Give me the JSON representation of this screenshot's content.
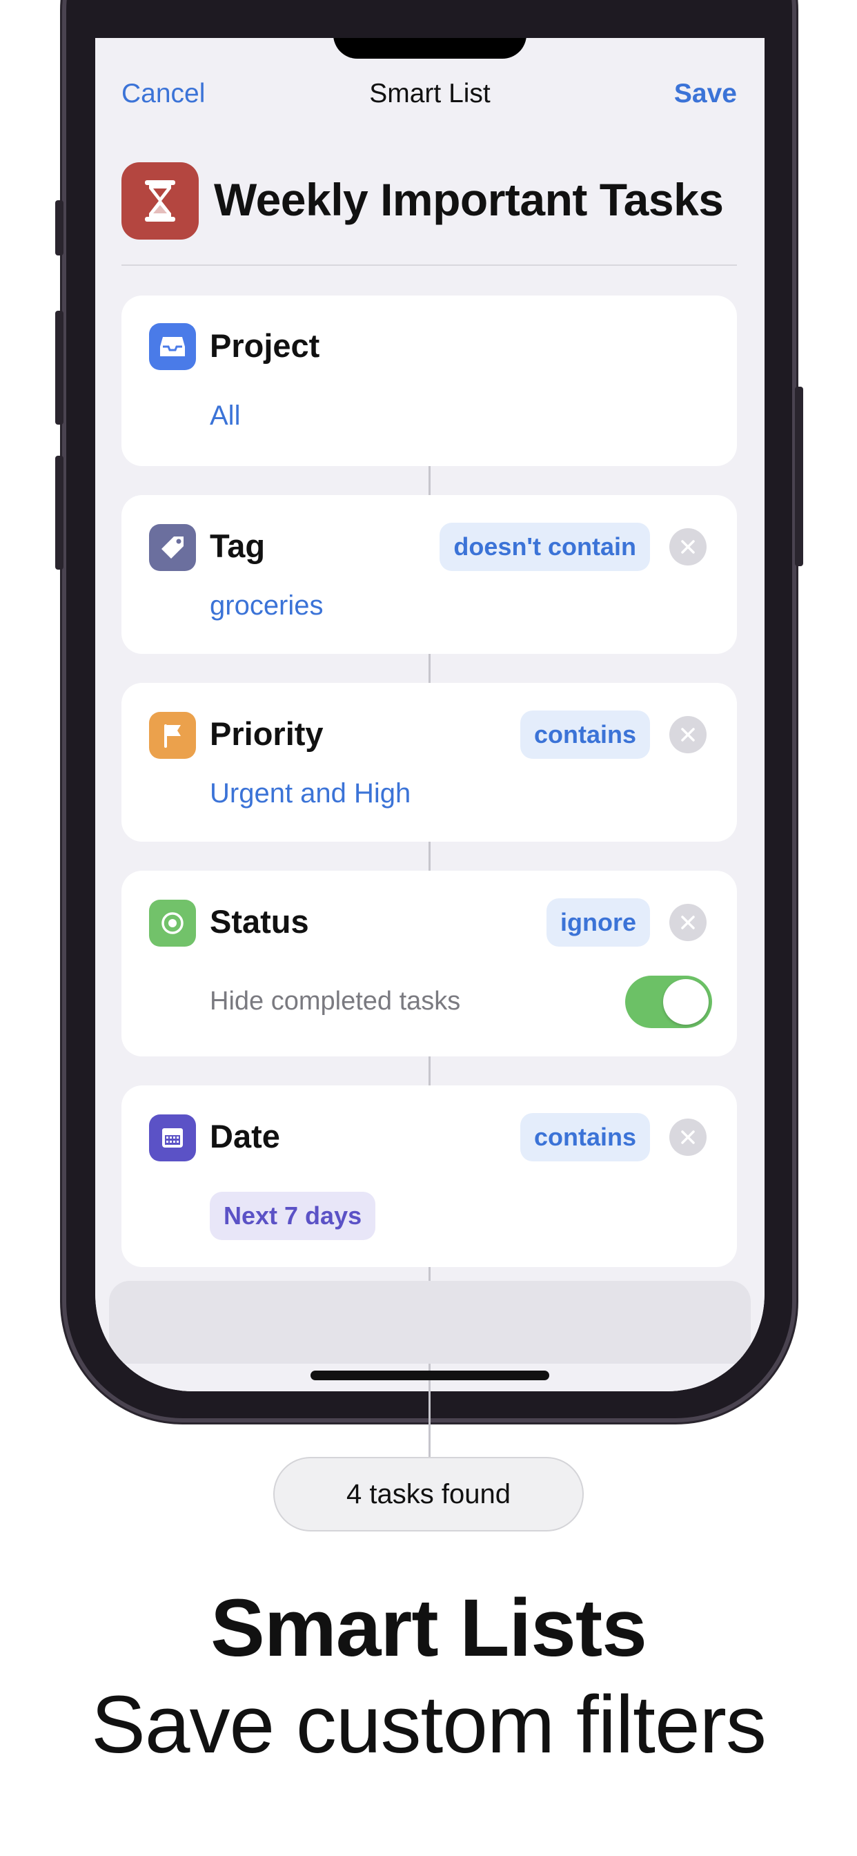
{
  "navbar": {
    "cancel_label": "Cancel",
    "title": "Smart List",
    "save_label": "Save"
  },
  "list": {
    "title": "Weekly Important Tasks",
    "icon": "hourglass-icon",
    "icon_color": "#b44640"
  },
  "filters": [
    {
      "label": "Project",
      "value": "All",
      "icon": "tray-icon",
      "icon_color": "#4a7be8"
    },
    {
      "label": "Tag",
      "operator": "doesn't contain",
      "value": "groceries",
      "icon": "tag-icon",
      "icon_color": "#6b6f9e"
    },
    {
      "label": "Priority",
      "operator": "contains",
      "value": "Urgent and High",
      "icon": "flag-icon",
      "icon_color": "#eba14c"
    },
    {
      "label": "Status",
      "operator": "ignore",
      "option_label": "Hide completed tasks",
      "option_on": true,
      "icon": "target-icon",
      "icon_color": "#72c26a"
    },
    {
      "label": "Date",
      "operator": "contains",
      "value": "Next 7 days",
      "icon": "calendar-icon",
      "icon_color": "#5b52c6"
    }
  ],
  "result": {
    "label": "4 tasks found"
  },
  "marketing": {
    "headline": "Smart Lists",
    "subline": "Save custom filters"
  },
  "colors": {
    "accent": "#3b73d7",
    "toggle_on": "#6cc166",
    "sheet_bg": "#f1f0f5"
  }
}
